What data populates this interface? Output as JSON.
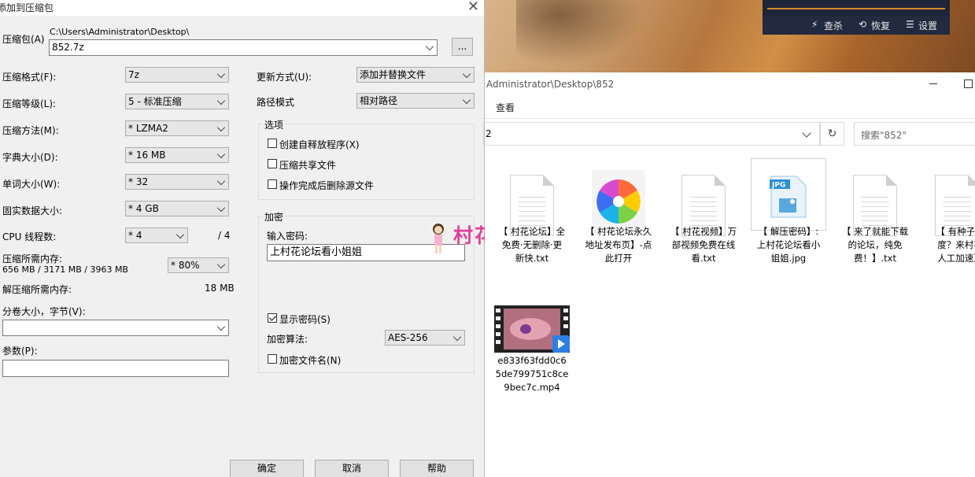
{
  "dialog": {
    "title": "添加到压缩包",
    "archive_label": "压缩包(A)",
    "archive_dir": "C:\\Users\\Administrator\\Desktop\\",
    "archive_name": "852.7z",
    "browse_label": "...",
    "format_label": "压缩格式(F):",
    "format_value": "7z",
    "level_label": "压缩等级(L):",
    "level_value": "5 - 标准压缩",
    "method_label": "压缩方法(M):",
    "method_value": "* LZMA2",
    "dict_label": "字典大小(D):",
    "dict_value": "* 16 MB",
    "word_label": "单词大小(W):",
    "word_value": "* 32",
    "solid_label": "固实数据大小:",
    "solid_value": "* 4 GB",
    "threads_label": "CPU 线程数:",
    "threads_value": "* 4",
    "threads_total": "/ 4",
    "mem_label": "压缩所需内存:",
    "mem_detail": "656 MB / 3171 MB / 3963 MB",
    "mem_percent": "* 80%",
    "decomp_label": "解压缩所需内存:",
    "decomp_value": "18 MB",
    "split_label": "分卷大小，字节(V):",
    "split_value": "",
    "params_label": "参数(P):",
    "params_value": "",
    "update_label": "更新方式(U):",
    "update_value": "添加并替换文件",
    "pathmode_label": "路径模式",
    "pathmode_value": "相对路径",
    "options_title": "选项",
    "opt_sfx": "创建自释放程序(X)",
    "opt_shared": "压缩共享文件",
    "opt_delete": "操作完成后删除源文件",
    "encrypt_title": "加密",
    "password_label": "输入密码:",
    "password_value": "上村花论坛看小姐姐",
    "show_password": "显示密码(S)",
    "enc_method_label": "加密算法:",
    "enc_method_value": "AES-256",
    "encrypt_names": "加密文件名(N)",
    "ok": "确定",
    "cancel": "取消",
    "help": "帮助"
  },
  "watermark": "村花论坛",
  "player": {
    "menu1": "查杀",
    "menu2": "恢复",
    "menu3": "设置"
  },
  "explorer": {
    "path": "Administrator\\Desktop\\852",
    "menu_view": "查看",
    "address": "2",
    "search_placeholder": "搜索\"852\"",
    "files": [
      {
        "line1": "【 村花论坛】全",
        "line2": "免费·无删除·更",
        "line3": "新快.txt",
        "type": "txt"
      },
      {
        "line1": "【 村花论坛永久",
        "line2": "地址发布页】-点",
        "line3": "此打开",
        "type": "app"
      },
      {
        "line1": "【 村花视频】万",
        "line2": "部视频免费在线",
        "line3": "看.txt",
        "type": "txt"
      },
      {
        "line1": "【 解压密码】:",
        "line2": "上村花论坛看小",
        "line3": "姐姐.jpg",
        "type": "jpg"
      },
      {
        "line1": "【 来了就能下载",
        "line2": "的论坛，纯免",
        "line3": "费！】.txt",
        "type": "txt"
      },
      {
        "line1": "【 有种子就",
        "line2": "度？来村花",
        "line3": "人工加速】",
        "type": "txt"
      },
      {
        "line1": "e833f63fdd0c6",
        "line2": "5de799751c8ce",
        "line3": "9bec7c.mp4",
        "type": "video"
      }
    ]
  },
  "colors": {
    "watermark": "#e0409b",
    "dialog_bg": "#f0f0f0",
    "player_bg": "#1f2538"
  }
}
